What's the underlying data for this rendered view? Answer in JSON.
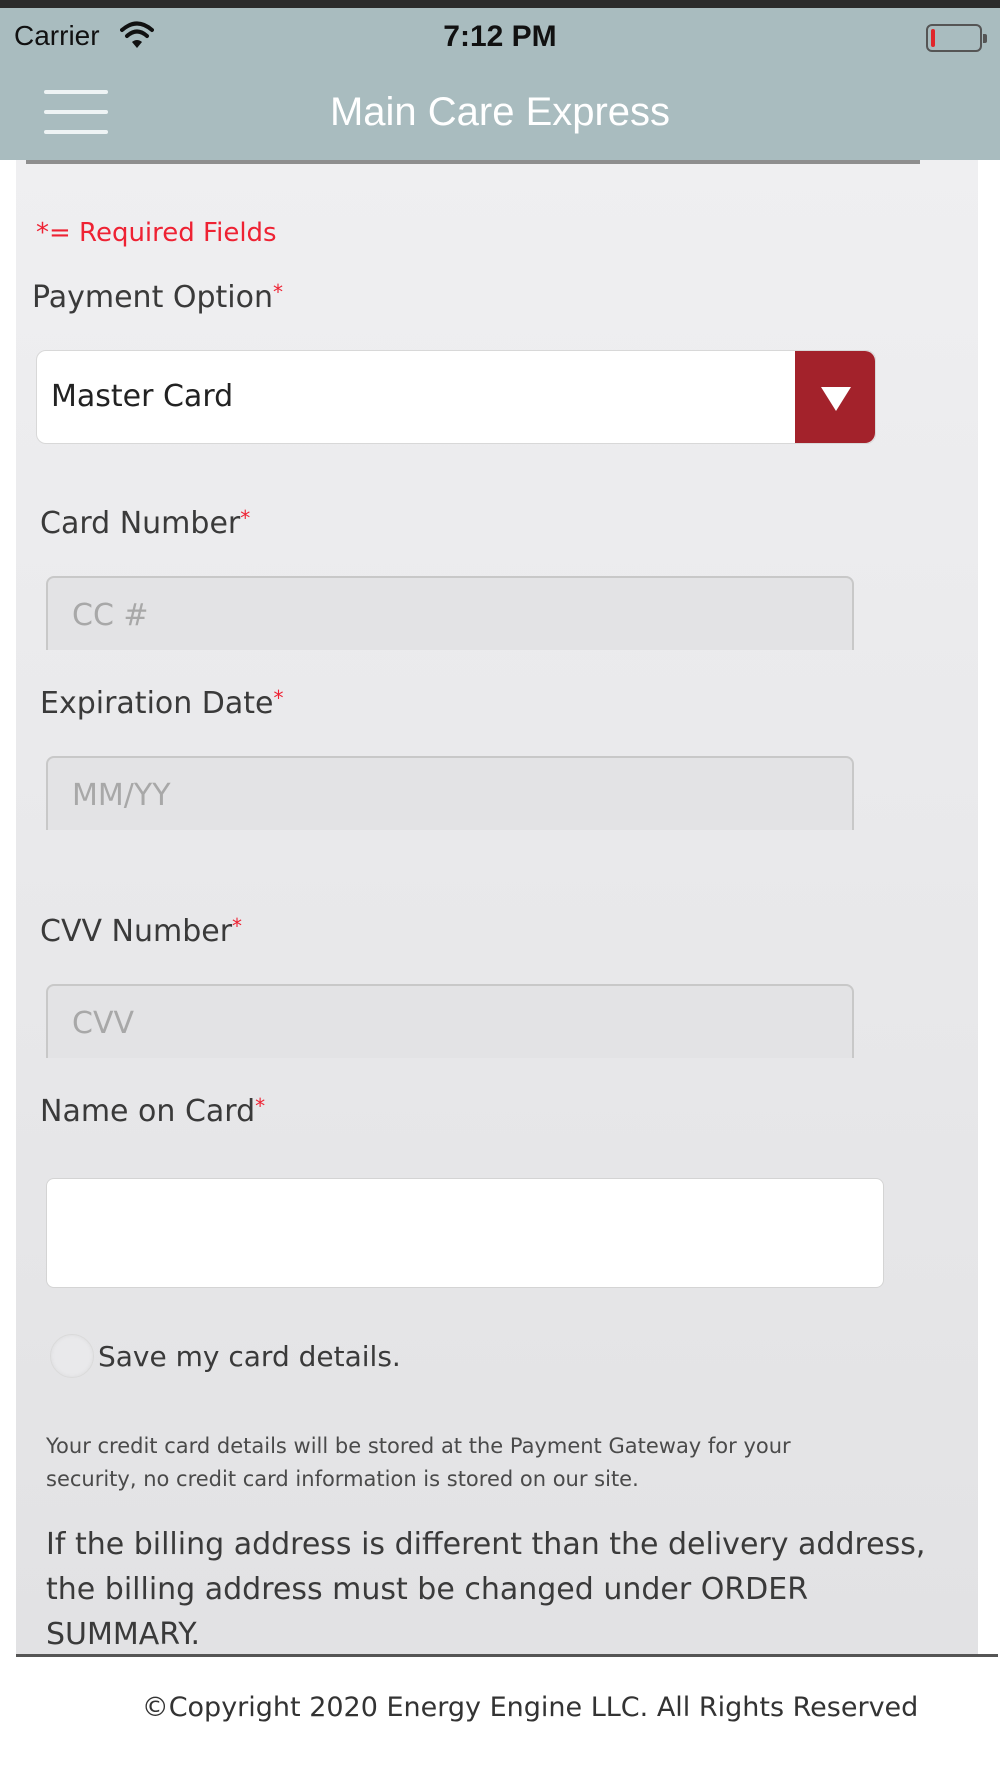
{
  "status_bar": {
    "carrier": "Carrier",
    "time": "7:12 PM",
    "wifi_icon": "wifi-icon",
    "battery_icon": "battery-low-icon",
    "battery_color": "#e0262b"
  },
  "header": {
    "title": "Main Care Express",
    "menu_icon": "hamburger-menu-icon",
    "background_color": "#a9bcbf"
  },
  "form": {
    "required_note": "*= Required Fields",
    "required_marker": "*",
    "payment_option": {
      "label": "Payment Option",
      "selected": "Master Card",
      "arrow_color": "#a3222b"
    },
    "card_number": {
      "label": "Card Number",
      "placeholder": "CC #"
    },
    "expiration_date": {
      "label": "Expiration Date",
      "placeholder": "MM/YY"
    },
    "cvv_number": {
      "label": "CVV Number",
      "placeholder": "CVV"
    },
    "name_on_card": {
      "label": "Name on Card",
      "value": ""
    },
    "save_card": {
      "label": "Save my card details.",
      "checked": false
    },
    "security_note": "Your credit card details will be stored at the Payment Gateway for your security, no credit card information is stored on our site.",
    "billing_note": "If the billing address is different than the delivery address, the billing address must be changed under ORDER SUMMARY."
  },
  "footer": {
    "copyright": "©Copyright 2020 Energy Engine LLC. All Rights Reserved"
  }
}
